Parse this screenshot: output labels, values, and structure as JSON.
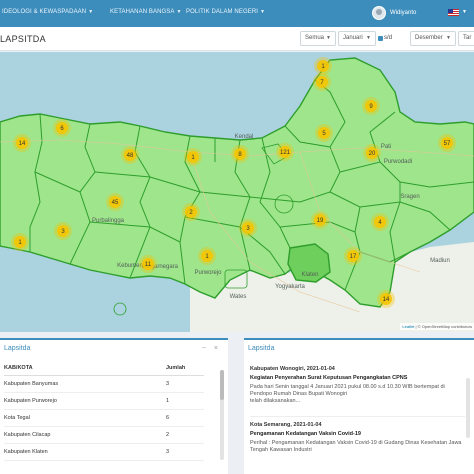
{
  "nav": {
    "items": [
      {
        "label": "IDEOLOGI & KEWASPADAAN"
      },
      {
        "label": "KETAHANAN BANGSA"
      },
      {
        "label": "POLITIK DALAM NEGERI"
      }
    ],
    "username": "Widiyanto"
  },
  "header": {
    "title": "LAPSITDA",
    "scope_select": "Semua",
    "month_from": "Januari",
    "range_separator": "s/d",
    "month_to": "Desember",
    "year_select": "Tar"
  },
  "map": {
    "colors": {
      "region_fill": "#9ee58c",
      "border": "#2e9e2b",
      "sea": "#aad3df",
      "land": "#eef0ea",
      "marker": "#f5c400"
    },
    "markers": [
      {
        "label": "1"
      },
      {
        "label": "6"
      },
      {
        "label": "14"
      },
      {
        "label": "9"
      },
      {
        "label": "5"
      },
      {
        "label": "48"
      },
      {
        "label": "45"
      },
      {
        "label": "3"
      },
      {
        "label": "1"
      },
      {
        "label": "11"
      },
      {
        "label": "1"
      },
      {
        "label": "2"
      },
      {
        "label": "8"
      },
      {
        "label": "121"
      },
      {
        "label": "7"
      },
      {
        "label": "20"
      },
      {
        "label": "57"
      },
      {
        "label": "19"
      },
      {
        "label": "4"
      },
      {
        "label": "3"
      },
      {
        "label": "17"
      },
      {
        "label": "14"
      },
      {
        "label": "1"
      }
    ],
    "places": [
      {
        "name": "Pati"
      },
      {
        "name": "Kendal"
      },
      {
        "name": "Purwodadi"
      },
      {
        "name": "Purbalingga"
      },
      {
        "name": "Banjarnegara"
      },
      {
        "name": "Purworejo"
      },
      {
        "name": "Klaten"
      },
      {
        "name": "Yogyakarta"
      },
      {
        "name": "Wates"
      },
      {
        "name": "Kebumen"
      },
      {
        "name": "Sragen"
      },
      {
        "name": "Madiun"
      }
    ],
    "attribution_leaflet": "Leaflet",
    "attribution_rest": "| © OpenStreetMap contributors"
  },
  "left_panel": {
    "title": "Lapsitda",
    "tools": {
      "minimize": "−",
      "close": "×"
    },
    "columns": [
      "KAB/KOTA",
      "Jumlah"
    ],
    "rows": [
      {
        "name": "Kabupaten Banyumas",
        "count": "3"
      },
      {
        "name": "Kabupaten Purworejo",
        "count": "1"
      },
      {
        "name": "Kota Tegal",
        "count": "6"
      },
      {
        "name": "Kabupaten Cilacap",
        "count": "2"
      },
      {
        "name": "Kabupaten Klaten",
        "count": "3"
      }
    ]
  },
  "right_panel": {
    "title": "Lapsitda",
    "news": [
      {
        "meta": "Kabupaten Wonogiri, 2021-01-04",
        "headline": "Kegiatan Penyerahan Surat Keputusan Pengangkatan CPNS",
        "excerpt": "Pada hari Senin tanggal 4 Januari 2021 pukul 08.00 s.d 10.30 WIB bertempat di Pendopo Rumah Dinas Bupati Wonogiri",
        "excerpt2": "telah dilaksanakan..."
      },
      {
        "meta": "Kota Semarang, 2021-01-04",
        "headline": "Pengamanan Kedatangan Vaksin Covid-19",
        "excerpt": "Perihal : Pengamanan Kedatangan Vaksin Covid-19 di Gudang Dinas Kesehatan Jawa Tengah Kawasan Industri"
      }
    ]
  }
}
